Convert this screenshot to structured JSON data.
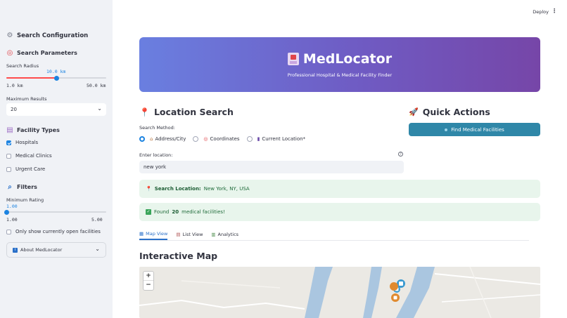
{
  "sidebar": {
    "title": "Search Configuration",
    "title_icon": "gear-icon",
    "params": {
      "heading": "Search Parameters",
      "heading_icon": "target-icon",
      "radius": {
        "label": "Search Radius",
        "value": 10.0,
        "value_label": "10.0 km",
        "min_label": "1.0 km",
        "max_label": "50.0 km",
        "fraction": 0.5
      },
      "max_results": {
        "label": "Maximum Results",
        "value": "20"
      }
    },
    "facility_types": {
      "heading": "Facility Types",
      "heading_icon": "clipboard-icon",
      "items": [
        {
          "label": "Hospitals",
          "checked": true
        },
        {
          "label": "Medical Clinics",
          "checked": false
        },
        {
          "label": "Urgent Care",
          "checked": false
        }
      ]
    },
    "filters": {
      "heading": "Filters",
      "heading_icon": "magnifier-icon",
      "rating": {
        "label": "Minimum Rating",
        "value_label": "1.00",
        "min_label": "1.00",
        "max_label": "5.00",
        "fraction": 0.0
      },
      "open_only": {
        "label": "Only show currently open facilities",
        "checked": false
      }
    },
    "about": {
      "label": "About MedLocator",
      "icon": "info-icon"
    }
  },
  "toolbar": {
    "deploy": "Deploy",
    "menu_icon": "kebab-icon"
  },
  "hero": {
    "icon": "hospital-icon",
    "title": "MedLocator",
    "subtitle": "Professional Hospital & Medical Facility Finder"
  },
  "location": {
    "heading": "Location Search",
    "heading_icon": "pin-icon",
    "method_label": "Search Method:",
    "methods": [
      {
        "label": "Address/City",
        "icon": "house-icon",
        "selected": true
      },
      {
        "label": "Coordinates",
        "icon": "target-icon",
        "selected": false
      },
      {
        "label": "Current Location*",
        "icon": "phone-icon",
        "selected": false
      }
    ],
    "input_label": "Enter location:",
    "input_value": "new york"
  },
  "quick": {
    "heading": "Quick Actions",
    "heading_icon": "rocket-icon",
    "button": "Find Medical Facilities",
    "button_icon": "dot-icon"
  },
  "alerts": {
    "location": {
      "bold": "Search Location:",
      "text": "New York, NY, USA"
    },
    "found": {
      "prefix": "Found",
      "count": "20",
      "suffix": "medical facilities!"
    }
  },
  "tabs": [
    {
      "label": "Map View",
      "icon": "map-icon",
      "active": true
    },
    {
      "label": "List View",
      "icon": "list-icon",
      "active": false
    },
    {
      "label": "Analytics",
      "icon": "chart-icon",
      "active": false
    }
  ],
  "map": {
    "title": "Interactive Map",
    "zoom_in": "+",
    "zoom_out": "−"
  },
  "colors": {
    "accent": "#1c83e1",
    "primary_button": "#2f87a8",
    "success_bg": "#e8f5ec",
    "hero_start": "#6a7fe0",
    "hero_end": "#7646a8"
  }
}
